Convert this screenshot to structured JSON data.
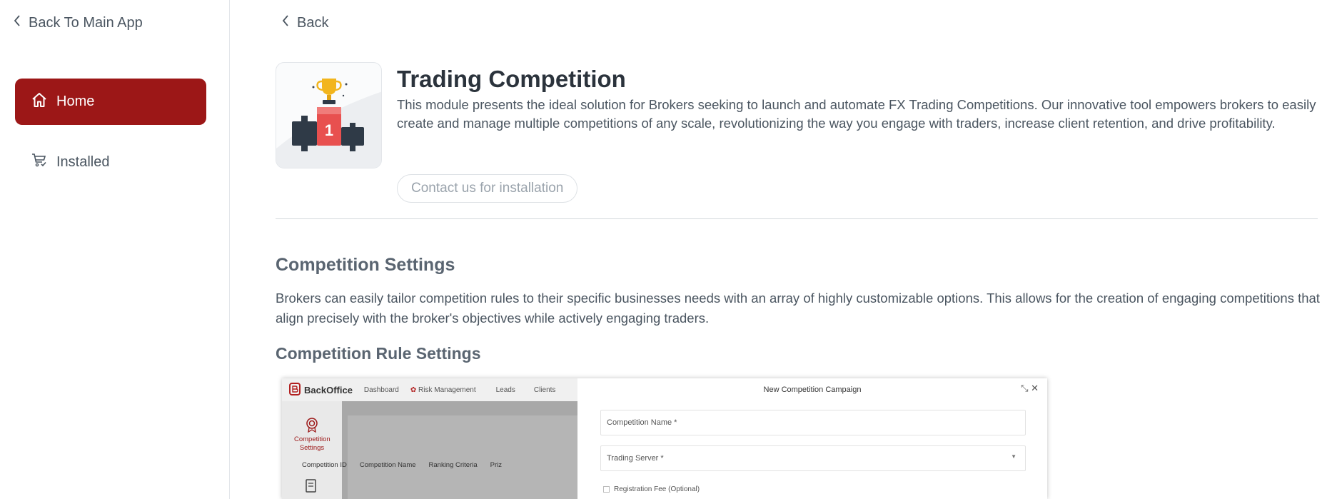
{
  "sidebar": {
    "back_to_main": "Back To Main App",
    "items": [
      {
        "label": "Home",
        "icon": "home-icon",
        "active": true
      },
      {
        "label": "Installed",
        "icon": "cart-check-icon",
        "active": false
      }
    ]
  },
  "main": {
    "back_label": "Back",
    "app": {
      "title": "Trading Competition",
      "description": "This module presents the ideal solution for Brokers seeking to launch and automate FX Trading Competitions. Our innovative tool empowers brokers to easily create and manage multiple competitions of any scale, revolutionizing the way you engage with traders, increase client retention, and drive profitability.",
      "contact_button": "Contact us for installation",
      "icon": "trophy-podium-icon",
      "icon_number": "1"
    },
    "sections": {
      "settings_heading": "Competition Settings",
      "settings_text": "Brokers can easily tailor competition rules to their specific businesses needs with an array of highly customizable options. This allows for the creation of engaging competitions that align precisely with the broker's objectives while actively engaging traders.",
      "rules_heading": "Competition Rule Settings"
    },
    "screenshot": {
      "logo": "BackOffice",
      "nav": [
        "Dashboard",
        "Risk Management",
        "Leads",
        "Clients"
      ],
      "side_item": "Competition Settings",
      "columns": [
        "Competition ID",
        "Competition Name",
        "Ranking Criteria",
        "Priz"
      ],
      "panel_title": "New Competition Campaign",
      "fields": [
        "Competition Name *",
        "Trading Server *"
      ],
      "checkbox": "Registration Fee (Optional)"
    }
  },
  "colors": {
    "accent": "#9c1717",
    "text": "#4a5560",
    "heading": "#5a6571"
  }
}
